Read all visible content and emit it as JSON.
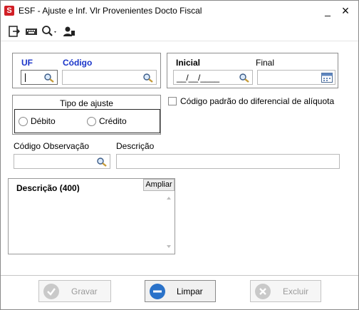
{
  "window": {
    "app_icon_letter": "S",
    "title": "ESF - Ajuste e Inf. Vlr Provenientes Docto Fiscal",
    "minimize_glyph": "_",
    "close_glyph": "×"
  },
  "toolbar": {
    "icons": [
      "exit-icon",
      "keyboard-icon",
      "search-icon",
      "user-icon"
    ]
  },
  "uf_codigo": {
    "uf_label": "UF",
    "uf_value": "",
    "codigo_label": "Código",
    "codigo_value": ""
  },
  "periodo": {
    "inicial_label": "Inicial",
    "inicial_value": "__/__/____",
    "final_label": "Final",
    "final_value": ""
  },
  "tipo_ajuste": {
    "label": "Tipo de ajuste",
    "options": [
      "Débito",
      "Crédito"
    ]
  },
  "codigo_padrao": {
    "label": "Código padrão do diferencial de alíquota",
    "checked": false
  },
  "observacao": {
    "codigo_label": "Código Observação",
    "codigo_value": "",
    "descricao_label": "Descrição",
    "descricao_value": ""
  },
  "descricao_area": {
    "label": "Descrição (400)",
    "expand_label": "Ampliar",
    "value": ""
  },
  "footer": {
    "gravar_label": "Gravar",
    "limpar_label": "Limpar",
    "excluir_label": "Excluir"
  },
  "colors": {
    "label_blue": "#1a35c9",
    "limpar_blue": "#2a72c9",
    "disabled_gray": "#9a9a9a"
  }
}
